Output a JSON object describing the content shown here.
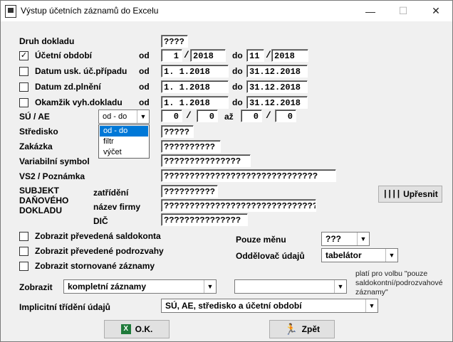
{
  "window": {
    "title": "Výstup účetních záznamů do Excelu",
    "minimize_glyph": "—",
    "maximize_glyph": "☐",
    "close_glyph": "✕"
  },
  "druh": {
    "label": "Druh dokladu",
    "value": "????"
  },
  "od_label": "od",
  "do_label": "do",
  "rows": {
    "ucetni": {
      "label": "Účetní období",
      "checked": true,
      "check_glyph": "✓",
      "od_month": "1",
      "od_year": "2018",
      "do_month": "11",
      "do_year": "2018",
      "slash": "/"
    },
    "datum_usk": {
      "label": "Datum usk. úč.případu",
      "od": "1. 1.2018",
      "do": "31.12.2018"
    },
    "datum_zd": {
      "label": "Datum zd.plnění",
      "od": "1. 1.2018",
      "do": "31.12.2018"
    },
    "okamzik": {
      "label": "Okamžik vyh.dokladu",
      "od": "1. 1.2018",
      "do": "31.12.2018"
    }
  },
  "su_ae": {
    "label": "SÚ / AE",
    "mode": "od - do",
    "from_a": "0",
    "from_b": "0",
    "to_label": "až",
    "to_a": "0",
    "to_b": "0",
    "slash": "/",
    "options": [
      "od - do",
      "filtr",
      "výčet"
    ]
  },
  "stredisko": {
    "label": "Středisko",
    "value": "?????"
  },
  "zakazka": {
    "label": "Zakázka",
    "value": "??????????"
  },
  "variabilni": {
    "label": "Variabilní symbol",
    "value": "???????????????"
  },
  "vs2": {
    "label": "VS2 / Poznámka",
    "value": "??????????????????????????????"
  },
  "subjekt": {
    "label_line1": "SUBJEKT",
    "label_line2": "DAŇOVÉHO",
    "label_line3": "DOKLADU",
    "zatrideni_label": "zatřídění",
    "zatrideni_value": "??????????",
    "nazev_label": "název firmy",
    "nazev_value": "??????????????????????????????",
    "dic_label": "DIČ",
    "dic_value": "???????????????"
  },
  "upresnit_label": "Upřesnit",
  "checkboxes": {
    "saldokonta": "Zobrazit převedená saldokonta",
    "podrozvahy": "Zobrazit převedené podrozvahy",
    "storno": "Zobrazit stornované záznamy"
  },
  "pouze_menu": {
    "label": "Pouze měnu",
    "value": "???"
  },
  "oddelovac": {
    "label": "Oddělovač údajů",
    "value": "tabelátor"
  },
  "zobrazit": {
    "label": "Zobrazit",
    "value": "kompletní záznamy",
    "second_value": "",
    "note": "platí pro volbu \"pouze saldokontní/podrozvahové záznamy\""
  },
  "implicitni": {
    "label": "Implicitní třídění údajů",
    "value": "SÚ, AE, středisko a účetní období"
  },
  "ok_label": "O.K.",
  "zpet_label": "Zpět",
  "colors": {
    "selection": "#0078d7",
    "excel_green": "#1f7a3a",
    "runner_green": "#2e9e2e"
  }
}
